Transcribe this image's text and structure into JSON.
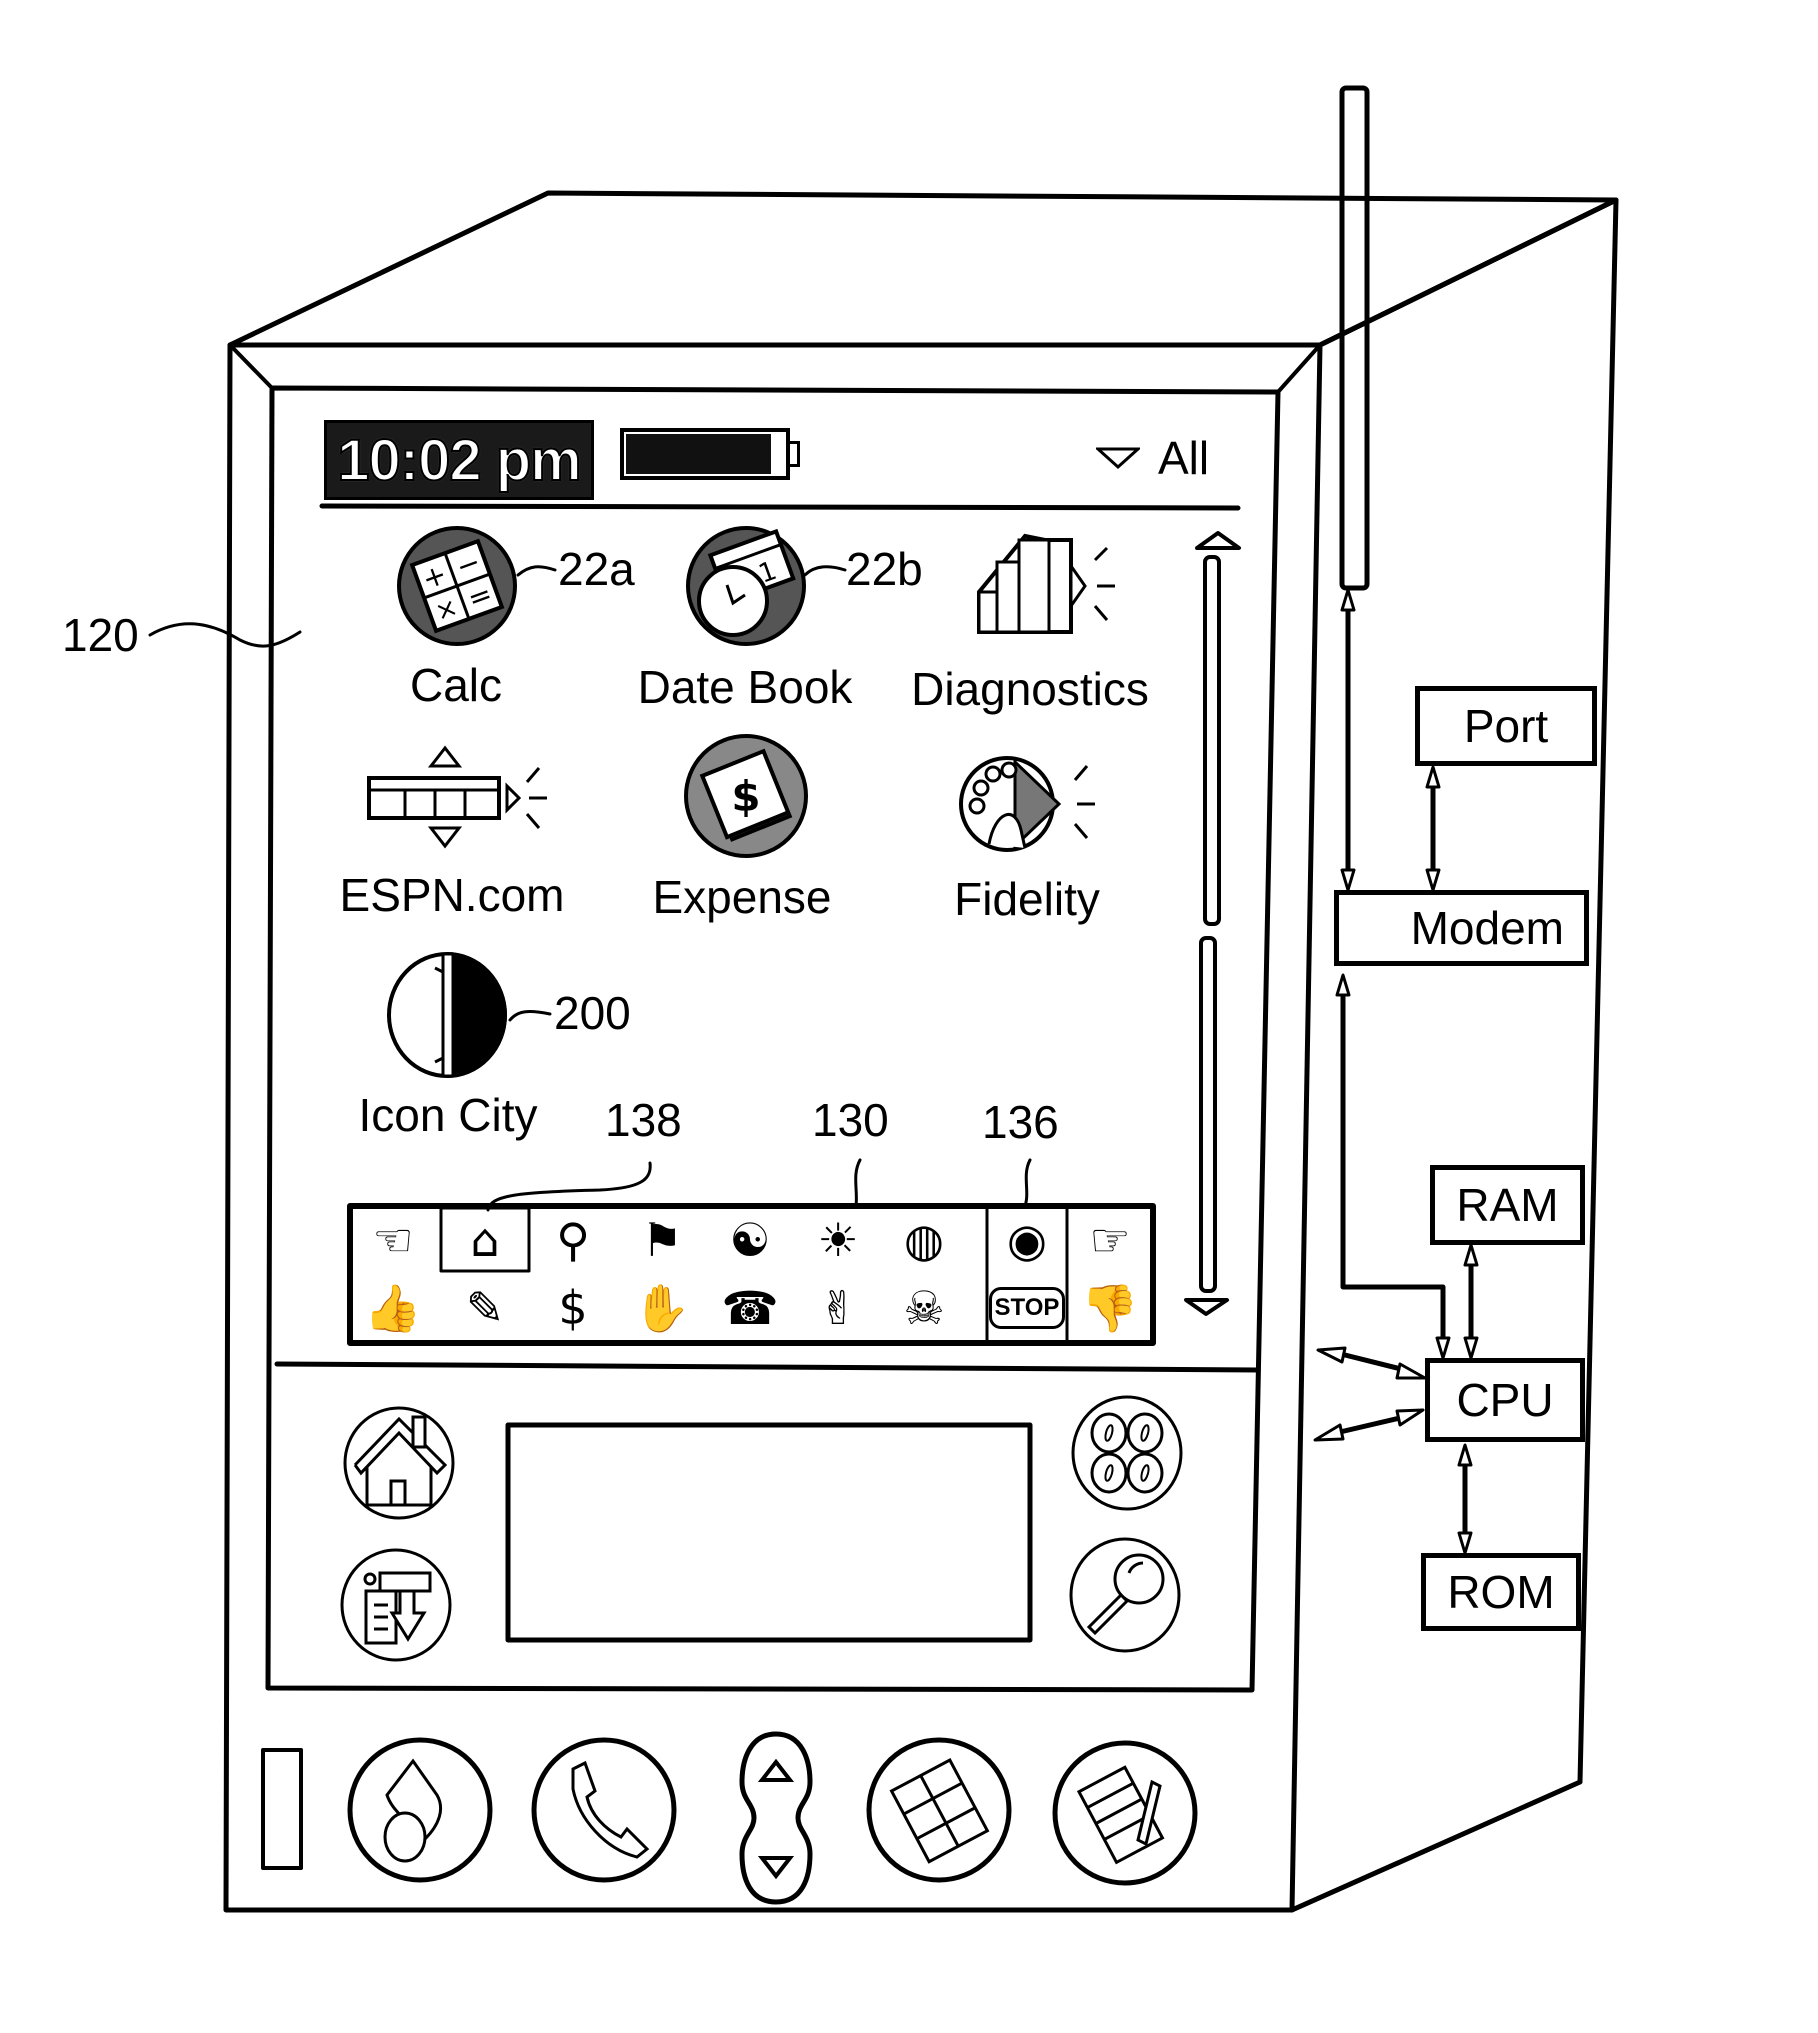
{
  "device": {
    "reference_label": "120",
    "status_bar": {
      "time": "10:02 pm",
      "battery_level_fraction": 0.92,
      "category_selector": "All"
    },
    "apps": [
      {
        "label": "Calc",
        "icon": "calculator-icon",
        "ref": "22a"
      },
      {
        "label": "Date Book",
        "icon": "date-book-icon",
        "ref": "22b"
      },
      {
        "label": "Diagnostics",
        "icon": "diagnostics-icon",
        "ref": ""
      },
      {
        "label": "ESPN.com",
        "icon": "espn-icon",
        "ref": ""
      },
      {
        "label": "Expense",
        "icon": "expense-icon",
        "ref": ""
      },
      {
        "label": "Fidelity",
        "icon": "fidelity-icon",
        "ref": ""
      },
      {
        "label": "Icon City",
        "icon": "icon-city-icon",
        "ref": "200"
      }
    ],
    "toolbar": {
      "refs": {
        "selected_icon": "138",
        "toolbar": "130",
        "section": "136"
      },
      "top_row": [
        {
          "name": "pointing-hand-icon",
          "glyph": "☜"
        },
        {
          "name": "house-scene-icon",
          "glyph": "⌂"
        },
        {
          "name": "magnifier-fish-icon",
          "glyph": "⚲"
        },
        {
          "name": "checkered-flags-icon",
          "glyph": "⚑"
        },
        {
          "name": "yin-yang-icon",
          "glyph": "☯"
        },
        {
          "name": "sunrise-sailboat-icon",
          "glyph": "☀"
        },
        {
          "name": "globe-icon",
          "glyph": "◍"
        },
        {
          "name": "eye-icon",
          "glyph": "◉"
        },
        {
          "name": "crossed-fingers-icon",
          "glyph": "☞"
        }
      ],
      "bottom_row": [
        {
          "name": "thumbs-up-icon",
          "glyph": "👍"
        },
        {
          "name": "artist-easel-icon",
          "glyph": "✎"
        },
        {
          "name": "money-icon",
          "glyph": "$"
        },
        {
          "name": "drink-hand-icon",
          "glyph": "✋"
        },
        {
          "name": "phone-keypad-icon",
          "glyph": "☎"
        },
        {
          "name": "ok-hand-icon",
          "glyph": "✌"
        },
        {
          "name": "skull-crossbones-icon",
          "glyph": "☠"
        },
        {
          "name": "stop-sign-icon",
          "glyph": "STOP"
        },
        {
          "name": "thumbs-down-icon",
          "glyph": "👎"
        }
      ]
    },
    "silkscreen_buttons": [
      {
        "name": "home-button",
        "icon": "home-icon"
      },
      {
        "name": "menu-button",
        "icon": "menu-icon"
      },
      {
        "name": "calculator-button",
        "icon": "calc-keys-icon"
      },
      {
        "name": "find-button",
        "icon": "search-icon"
      }
    ],
    "hardware_buttons": [
      {
        "name": "datebook-button",
        "icon": "datebook-hw-icon"
      },
      {
        "name": "phone-button",
        "icon": "phone-icon"
      },
      {
        "name": "scroll-rocker",
        "icon": "up-down-icon"
      },
      {
        "name": "address-button",
        "icon": "grid-icon"
      },
      {
        "name": "memo-button",
        "icon": "memo-icon"
      }
    ]
  },
  "components": {
    "port": "Port",
    "modem": "Modem",
    "ram": "RAM",
    "cpu": "CPU",
    "rom": "ROM"
  }
}
